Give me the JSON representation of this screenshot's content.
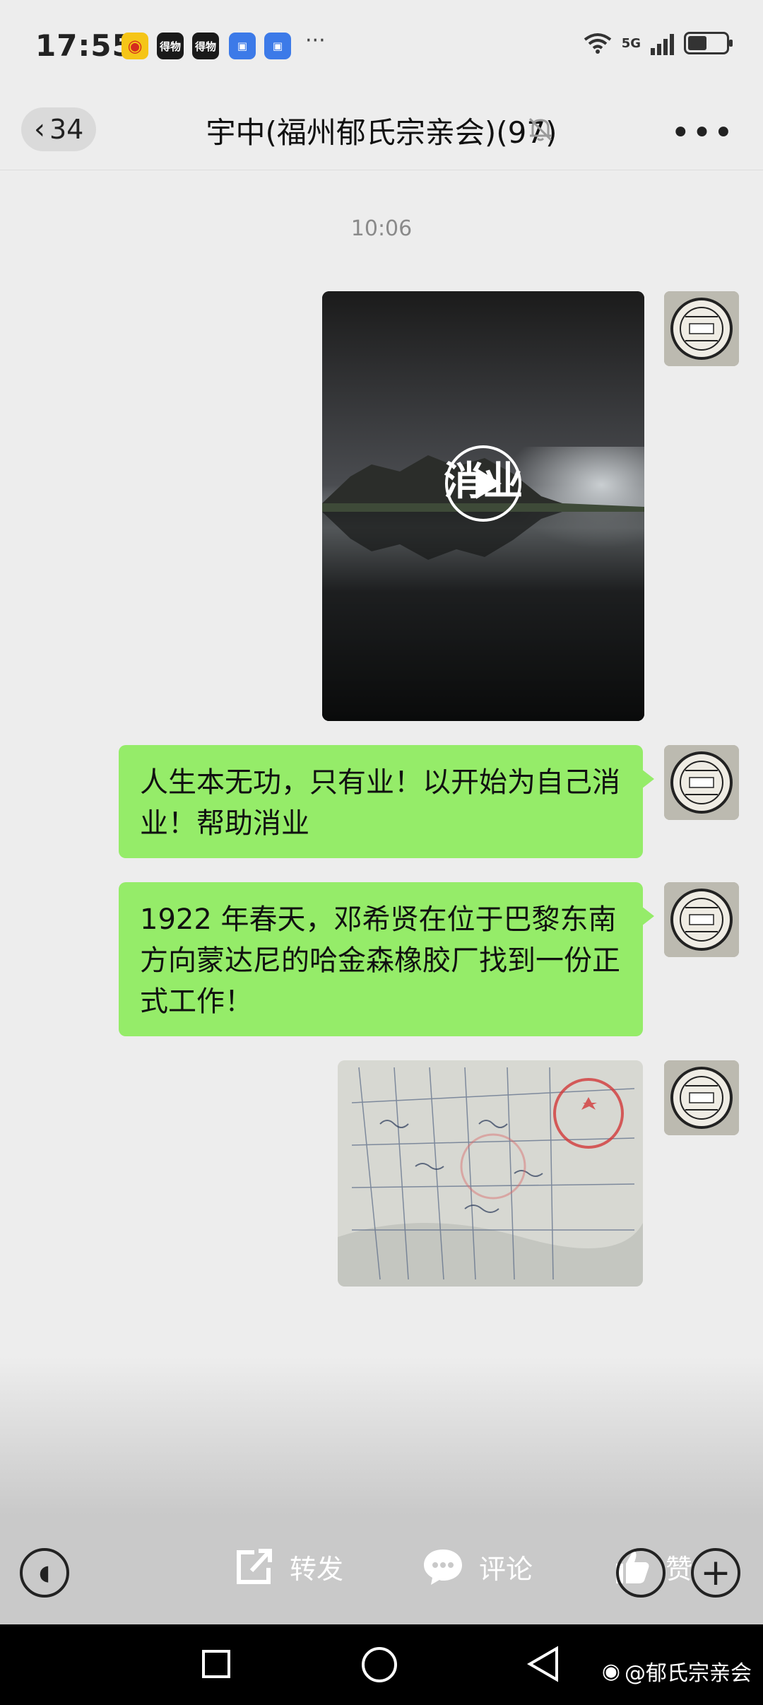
{
  "status_bar": {
    "time": "17:55",
    "app_icons": [
      "weibo-icon",
      "dewu-icon",
      "dewu-icon",
      "blue-app-icon",
      "blue-app-icon"
    ],
    "dewu_label": "得物",
    "more": "···",
    "network": "5G",
    "battery_level": 0.55
  },
  "nav": {
    "unread_count": "34",
    "title": "宇中(福州郁氏宗亲会)(97)"
  },
  "chat": {
    "timestamp": "10:06",
    "messages": [
      {
        "type": "video",
        "caption": "消业"
      },
      {
        "type": "text",
        "text": "人生本无功，只有业！以开始为自己消业！帮助消业"
      },
      {
        "type": "text",
        "text": "1922 年春天，邓希贤在位于巴黎东南方向蒙达尼的哈金森橡胶厂找到一份正式工作！"
      },
      {
        "type": "image",
        "description_icon": "labor-contract-document-image"
      }
    ]
  },
  "actions": {
    "share": "转发",
    "comment": "评论",
    "like": "赞"
  },
  "watermark": "@郁氏宗亲会",
  "colors": {
    "bubble": "#95ec69",
    "background": "#ededed"
  }
}
